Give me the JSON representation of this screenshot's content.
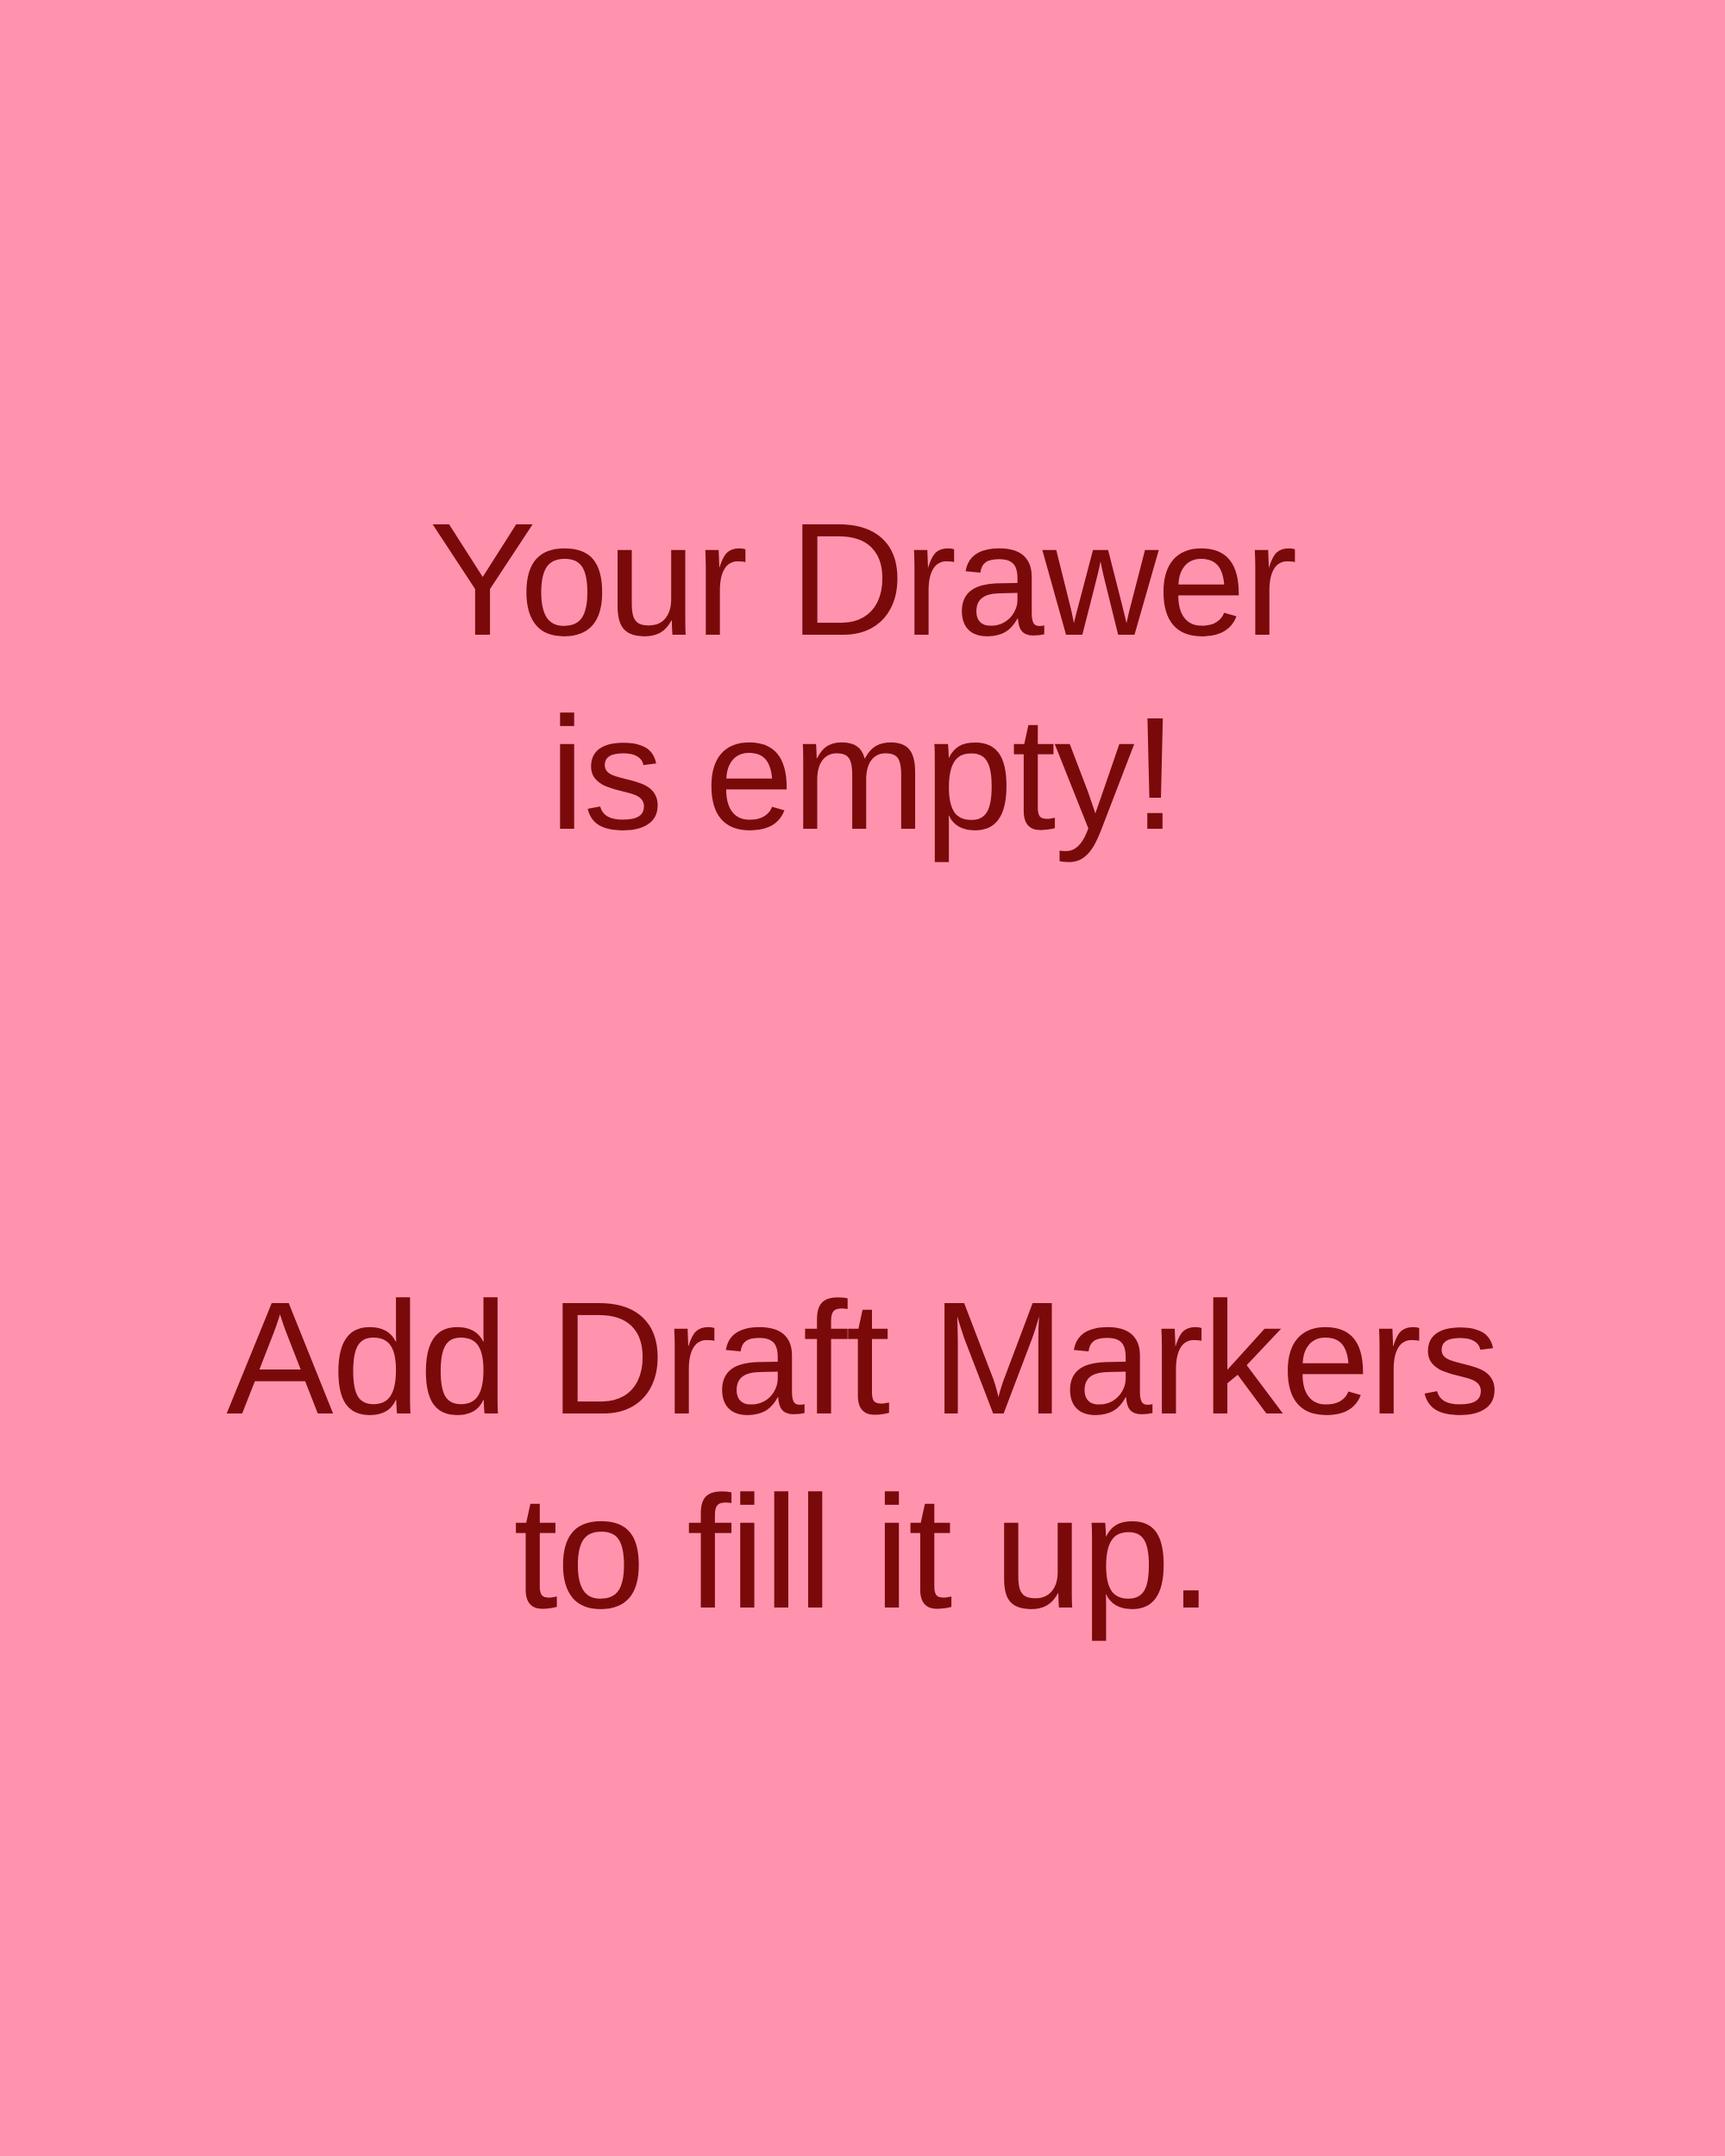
{
  "colors": {
    "background": "#ff93ae",
    "text": "#7a0a0a"
  },
  "empty_state": {
    "title_lines": [
      "Your Drawer",
      "is empty!"
    ],
    "hint_lines": [
      "Add Draft Markers",
      "to fill it up."
    ]
  }
}
